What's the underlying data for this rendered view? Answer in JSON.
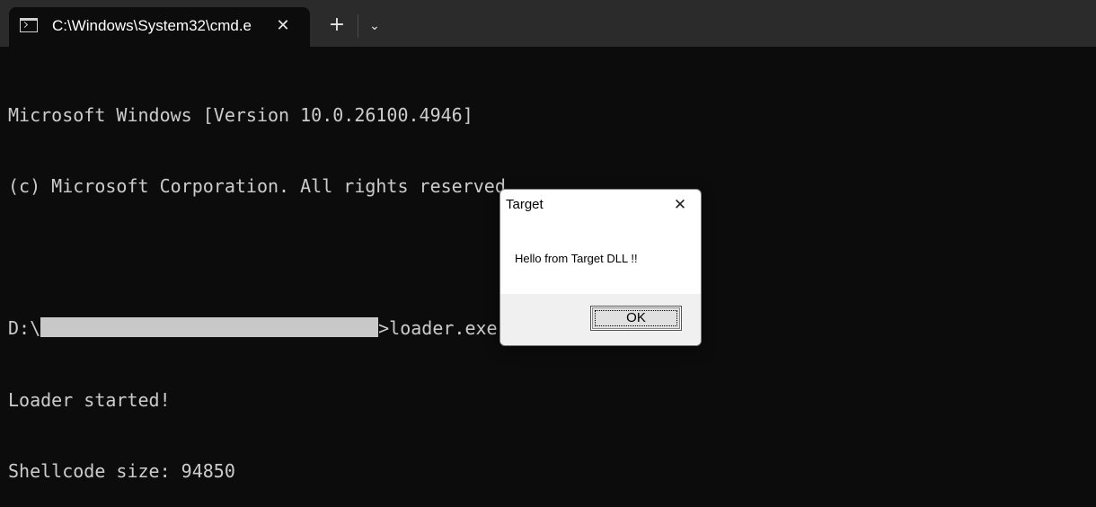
{
  "window": {
    "tab_title": "C:\\Windows\\System32\\cmd.e",
    "tab_icon": "console-icon",
    "close_icon": "✕",
    "new_tab_icon": "+",
    "dropdown_icon": "⌄"
  },
  "terminal": {
    "lines": [
      "Microsoft Windows [Version 10.0.26100.4946]",
      "(c) Microsoft Corporation. All rights reserved.",
      "",
      "",
      "Loader started!",
      "Shellcode size: 94850"
    ],
    "prompt_prefix": "D:\\",
    "command": ">loader.exe shellcode.bin"
  },
  "dialog": {
    "title": "Target",
    "close_icon": "✕",
    "message": "Hello from Target DLL !!",
    "ok_label": "OK"
  },
  "colors": {
    "terminal_bg": "#0c0c0c",
    "titlebar_bg": "#2b2b2b",
    "terminal_text": "#cccccc",
    "redaction": "#c8c8c8"
  }
}
